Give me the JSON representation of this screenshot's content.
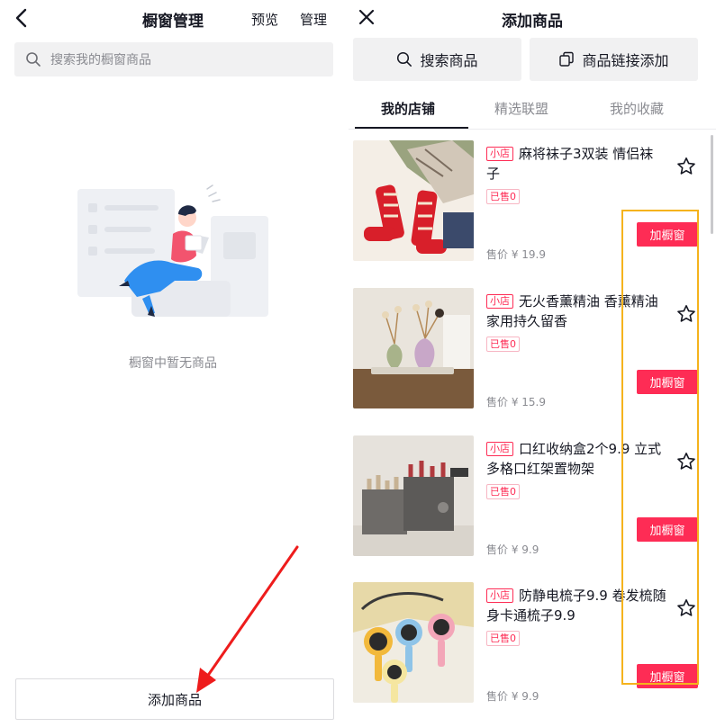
{
  "left": {
    "title": "橱窗管理",
    "preview": "预览",
    "manage": "管理",
    "search_placeholder": "搜索我的橱窗商品",
    "empty_text": "橱窗中暂无商品",
    "add_button": "添加商品"
  },
  "right": {
    "title": "添加商品",
    "search_button": "搜索商品",
    "link_button": "商品链接添加",
    "tabs": [
      {
        "label": "我的店铺",
        "active": true
      },
      {
        "label": "精选联盟",
        "active": false
      },
      {
        "label": "我的收藏",
        "active": false
      }
    ],
    "products": [
      {
        "badge": "小店",
        "title": "麻将袜子3双装 情侣袜子",
        "sold": "已售0",
        "price": "售价 ¥ 19.9",
        "action": "加橱窗",
        "thumb_icon": "socks-photo"
      },
      {
        "badge": "小店",
        "title": "无火香薰精油 香薰精油家用持久留香",
        "sold": "已售0",
        "price": "售价 ¥ 15.9",
        "action": "加橱窗",
        "thumb_icon": "aroma-diffuser-photo"
      },
      {
        "badge": "小店",
        "title": "口红收纳盒2个9.9 立式多格口红架置物架",
        "sold": "已售0",
        "price": "售价 ¥ 9.9",
        "action": "加橱窗",
        "thumb_icon": "lipstick-organizer-photo"
      },
      {
        "badge": "小店",
        "title": "防静电梳子9.9 卷发梳随身卡通梳子9.9",
        "sold": "已售0",
        "price": "售价 ¥ 9.9",
        "action": "加橱窗",
        "thumb_icon": "cartoon-combs-photo"
      }
    ]
  },
  "colors": {
    "accent": "#fe2c55",
    "highlight": "#f5b31d",
    "annotation_arrow": "#ee1c1c"
  }
}
